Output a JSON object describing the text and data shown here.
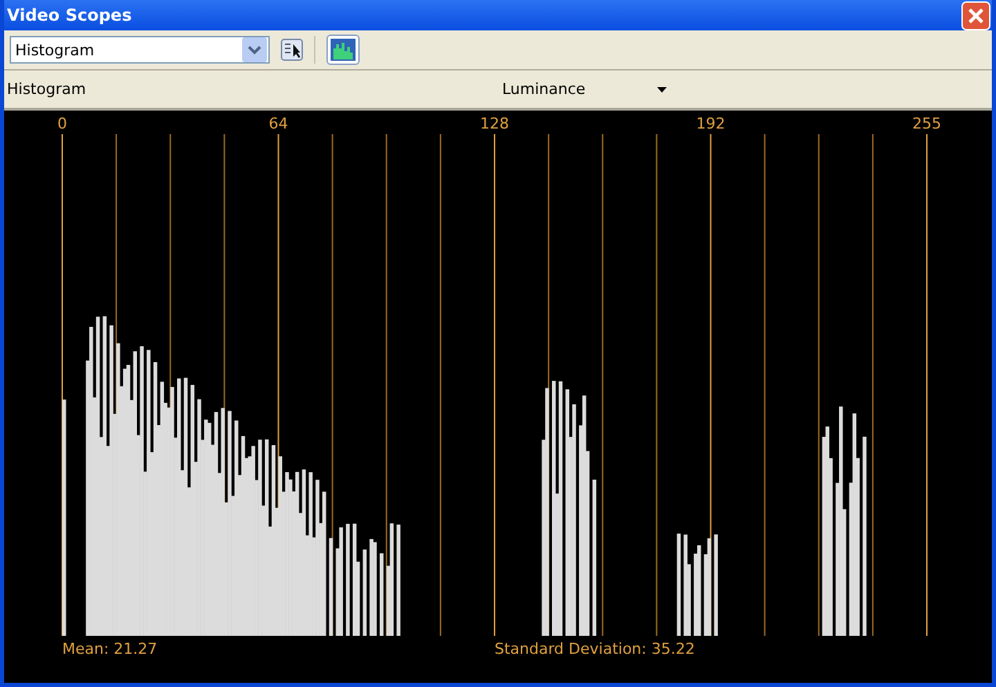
{
  "window": {
    "title": "Video Scopes"
  },
  "toolbar": {
    "scope_select": {
      "value": "Histogram"
    },
    "histogram_button": {
      "selected": true
    }
  },
  "header": {
    "title": "Histogram",
    "channel": "Luminance"
  },
  "scope": {
    "axis_labels": [
      "0",
      "64",
      "128",
      "192",
      "255"
    ],
    "stats": [
      {
        "text": "Mean: 21.27"
      },
      {
        "text": "Standard Deviation: 35.22"
      }
    ]
  }
}
